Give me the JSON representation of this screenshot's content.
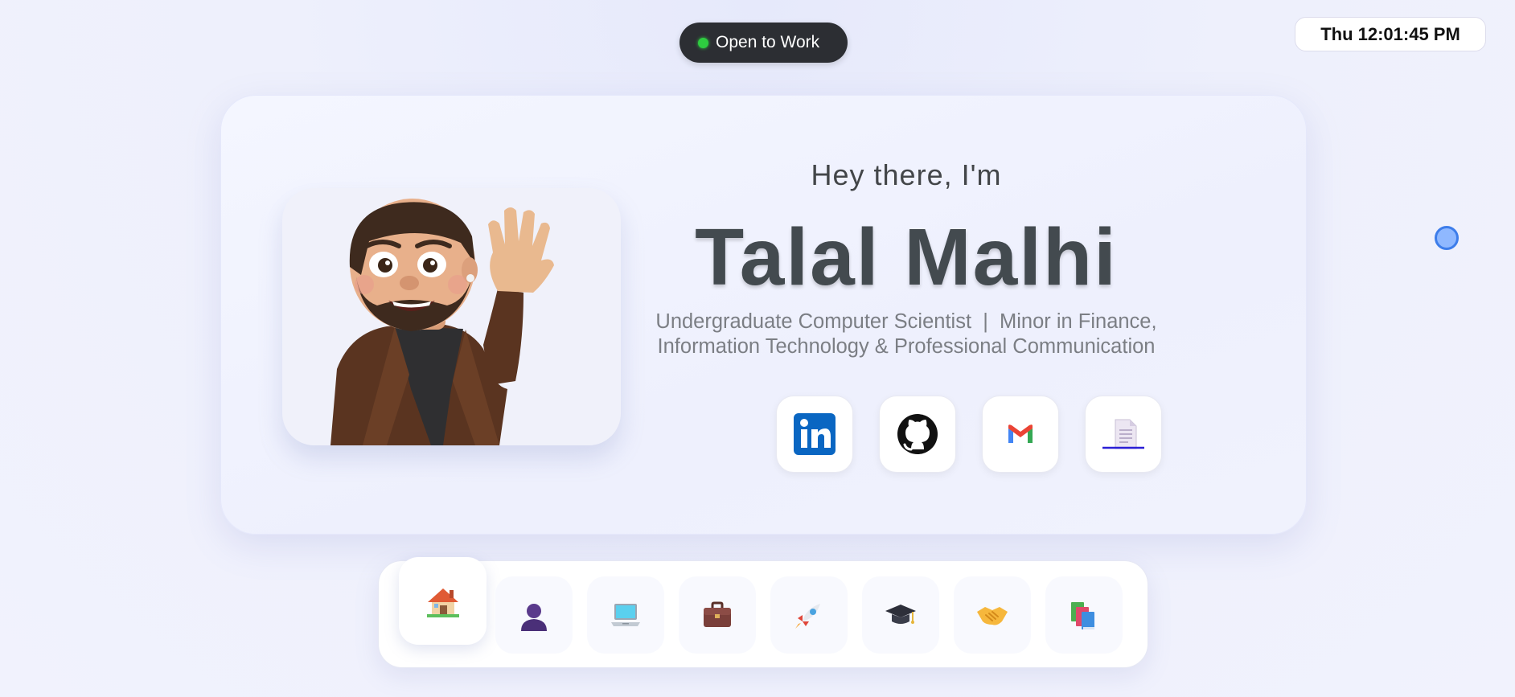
{
  "status": {
    "label": "Open to Work",
    "dot_color": "#2ecc40"
  },
  "clock": {
    "text": "Thu 12:01:45 PM"
  },
  "hero": {
    "greeting": "Hey there, I'm",
    "name": "Talal Malhi",
    "subtitle_line1": "Undergraduate Computer Scientist  |  Minor in Finance,",
    "subtitle_line2": "Information Technology & Professional Communication",
    "avatar_icon": "waving-memoji-avatar"
  },
  "socials": [
    {
      "icon": "linkedin-icon"
    },
    {
      "icon": "github-icon"
    },
    {
      "icon": "gmail-icon"
    },
    {
      "icon": "resume-document-icon"
    }
  ],
  "dock": {
    "active_index": 0,
    "items": [
      {
        "icon": "house-icon"
      },
      {
        "icon": "person-silhouette-icon"
      },
      {
        "icon": "laptop-icon"
      },
      {
        "icon": "briefcase-icon"
      },
      {
        "icon": "rocket-icon"
      },
      {
        "icon": "graduation-cap-icon"
      },
      {
        "icon": "handshake-icon"
      },
      {
        "icon": "books-icon"
      }
    ]
  },
  "colors": {
    "background": "#eef0fc",
    "name_text": "#434a4f",
    "status_pill": "#2c2e33",
    "cursor_fill": "#8fb8ff",
    "cursor_stroke": "#3d7dea"
  }
}
